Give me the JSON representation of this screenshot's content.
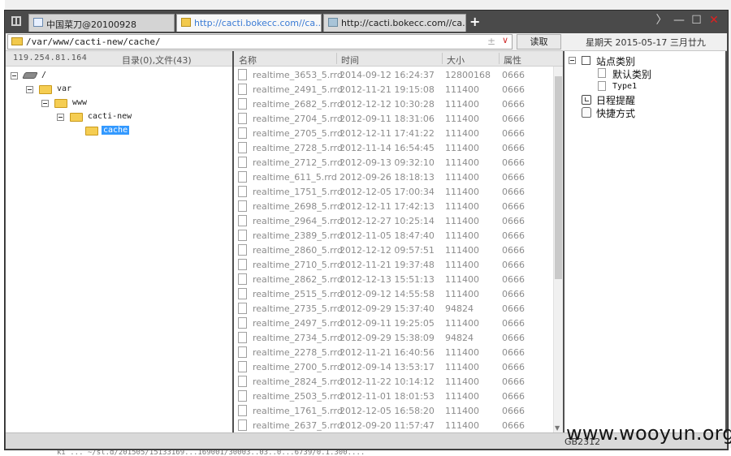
{
  "tabs": [
    {
      "label": "中国菜刀@20100928"
    },
    {
      "label": "http://cacti.bokecc.com//ca..."
    },
    {
      "label": "http://cacti.bokecc.com//ca..."
    }
  ],
  "tab_add_label": "+",
  "window_controls": {
    "next": "〉",
    "minimize": "—",
    "maximize": "☐",
    "close": "✕"
  },
  "address": {
    "path": "/var/www/cacti-new/cache/",
    "plus": "±",
    "dropdown": "∨",
    "read_button": "读取",
    "datetime": "星期天 2015-05-17 三月廿九"
  },
  "left_header": {
    "ip": "119.254.81.164",
    "summary": "目录(0),文件(43)"
  },
  "tree": [
    {
      "label": "/"
    },
    {
      "label": "var"
    },
    {
      "label": "www"
    },
    {
      "label": "cacti-new"
    },
    {
      "label": "cache"
    }
  ],
  "file_columns": {
    "name": "名称",
    "time": "时间",
    "size": "大小",
    "attr": "属性"
  },
  "files": [
    {
      "name": "realtime_3653_5.rrd",
      "time": "2014-09-12 16:24:37",
      "size": "12800168",
      "attr": "0666"
    },
    {
      "name": "realtime_2491_5.rrd",
      "time": "2012-11-21 19:15:08",
      "size": "111400",
      "attr": "0666"
    },
    {
      "name": "realtime_2682_5.rrd",
      "time": "2012-12-12 10:30:28",
      "size": "111400",
      "attr": "0666"
    },
    {
      "name": "realtime_2704_5.rrd",
      "time": "2012-09-11 18:31:06",
      "size": "111400",
      "attr": "0666"
    },
    {
      "name": "realtime_2705_5.rrd",
      "time": "2012-12-11 17:41:22",
      "size": "111400",
      "attr": "0666"
    },
    {
      "name": "realtime_2728_5.rrd",
      "time": "2012-11-14 16:54:45",
      "size": "111400",
      "attr": "0666"
    },
    {
      "name": "realtime_2712_5.rrd",
      "time": "2012-09-13 09:32:10",
      "size": "111400",
      "attr": "0666"
    },
    {
      "name": "realtime_611_5.rrd",
      "time": "2012-09-26 18:18:13",
      "size": "111400",
      "attr": "0666"
    },
    {
      "name": "realtime_1751_5.rrd",
      "time": "2012-12-05 17:00:34",
      "size": "111400",
      "attr": "0666"
    },
    {
      "name": "realtime_2698_5.rrd",
      "time": "2012-12-11 17:42:13",
      "size": "111400",
      "attr": "0666"
    },
    {
      "name": "realtime_2964_5.rrd",
      "time": "2012-12-27 10:25:14",
      "size": "111400",
      "attr": "0666"
    },
    {
      "name": "realtime_2389_5.rrd",
      "time": "2012-11-05 18:47:40",
      "size": "111400",
      "attr": "0666"
    },
    {
      "name": "realtime_2860_5.rrd",
      "time": "2012-12-12 09:57:51",
      "size": "111400",
      "attr": "0666"
    },
    {
      "name": "realtime_2710_5.rrd",
      "time": "2012-11-21 19:37:48",
      "size": "111400",
      "attr": "0666"
    },
    {
      "name": "realtime_2862_5.rrd",
      "time": "2012-12-13 15:51:13",
      "size": "111400",
      "attr": "0666"
    },
    {
      "name": "realtime_2515_5.rrd",
      "time": "2012-09-12 14:55:58",
      "size": "111400",
      "attr": "0666"
    },
    {
      "name": "realtime_2735_5.rrd",
      "time": "2012-09-29 15:37:40",
      "size": "94824",
      "attr": "0666"
    },
    {
      "name": "realtime_2497_5.rrd",
      "time": "2012-09-11 19:25:05",
      "size": "111400",
      "attr": "0666"
    },
    {
      "name": "realtime_2734_5.rrd",
      "time": "2012-09-29 15:38:09",
      "size": "94824",
      "attr": "0666"
    },
    {
      "name": "realtime_2278_5.rrd",
      "time": "2012-11-21 16:40:56",
      "size": "111400",
      "attr": "0666"
    },
    {
      "name": "realtime_2700_5.rrd",
      "time": "2012-09-14 13:53:17",
      "size": "111400",
      "attr": "0666"
    },
    {
      "name": "realtime_2824_5.rrd",
      "time": "2012-11-22 10:14:12",
      "size": "111400",
      "attr": "0666"
    },
    {
      "name": "realtime_2503_5.rrd",
      "time": "2012-11-01 18:01:53",
      "size": "111400",
      "attr": "0666"
    },
    {
      "name": "realtime_1761_5.rrd",
      "time": "2012-12-05 16:58:20",
      "size": "111400",
      "attr": "0666"
    },
    {
      "name": "realtime_2637_5.rrd",
      "time": "2012-09-20 11:57:47",
      "size": "111400",
      "attr": "0666"
    }
  ],
  "right_tree": [
    {
      "label": "站点类别"
    },
    {
      "label": "默认类别"
    },
    {
      "label": "Type1"
    },
    {
      "label": "日程提醒"
    },
    {
      "label": "快捷方式"
    }
  ],
  "status": {
    "encoding": "GB2312"
  },
  "watermark": "www.wooyun.org",
  "background_text": "ki ... ~/sl.d/201505/15133169...169001/30003..03..0...6739/0.1.300...."
}
